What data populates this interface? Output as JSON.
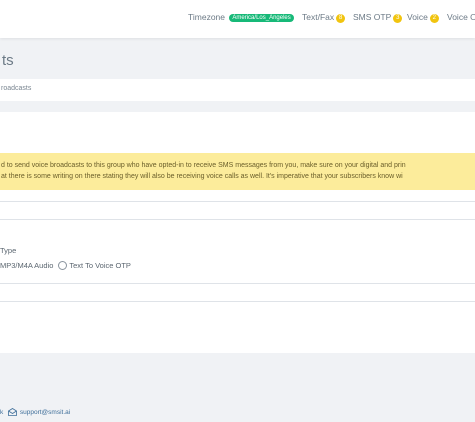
{
  "topbar": {
    "timezone_label": "Timezone",
    "timezone_value": "America/Los_Angeles",
    "text_fax_label": "Text/Fax",
    "text_fax_count": "8",
    "sms_otp_label": "SMS OTP",
    "sms_otp_count": "3",
    "voice_label": "Voice",
    "voice_count": "2",
    "voice_o_label": "Voice O"
  },
  "page": {
    "title": "ts",
    "breadcrumb": "roadcasts"
  },
  "alert": {
    "line1": "d to send voice broadcasts to this group who have opted-in to receive SMS messages from you, make sure on your digital and prin",
    "line2": "at there is some writing on there stating they will also be receiving voice calls as well. It's imperative that your subscribers know wi"
  },
  "form": {
    "type_label": "Type",
    "option_mp3": "MP3/M4A Audio",
    "option_tts": "Text To Voice OTP"
  },
  "footer": {
    "prefix": "k",
    "email": "support@smsit.ai"
  }
}
